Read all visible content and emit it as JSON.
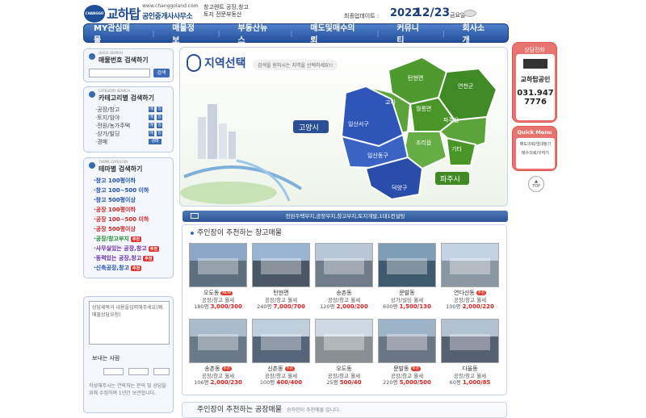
{
  "header": {
    "logo_mark": "CHANGGO",
    "logo_main": "교하탑",
    "logo_url": "www.changgoland.com",
    "logo_sub": "공인중개사사무소",
    "tagline_1": "창고렌트 공장,창고",
    "tagline_2": "토지 전문부동산",
    "update_label": "최종업데이트 :",
    "update_year": "2022",
    "update_date": "12/23",
    "update_day": "금요일"
  },
  "nav": {
    "items": [
      "MY관심매물",
      "매물정보",
      "부동산뉴스",
      "매도및매수의뢰",
      "커뮤니티",
      "회사소개"
    ]
  },
  "quick_search": {
    "small": "QUICK SEARCH",
    "title": "매물번호 검색하기",
    "button": "검색"
  },
  "category_search": {
    "small": "CATEGORY SEARCH",
    "title": "카테고리별 검색하기",
    "rows": [
      "·공장/창고",
      "·토지/임야",
      "·전원/농가주택",
      "·상가/빌딩",
      "·경매"
    ],
    "btn_a": "매",
    "btn_b": "임",
    "btn_wide": "경매"
  },
  "theme_search": {
    "small": "THEME CATEGORY",
    "title": "테마별 검색하기",
    "rows": [
      {
        "text": "·창고 100평이하",
        "color": "#1f4fb0",
        "tag": ""
      },
      {
        "text": "·창고 100~500 이하",
        "color": "#1f4fb0",
        "tag": ""
      },
      {
        "text": "·창고 500평이상",
        "color": "#1f4fb0",
        "tag": ""
      },
      {
        "text": "·공장 100평이하",
        "color": "#d42424",
        "tag": ""
      },
      {
        "text": "·공장 100~500 이하",
        "color": "#d42424",
        "tag": ""
      },
      {
        "text": "·공장 500평이상",
        "color": "#d42424",
        "tag": ""
      },
      {
        "text": "·공장/창고부지",
        "color": "#1c8a2e",
        "tag": "추천"
      },
      {
        "text": "·사무실있는 공장,창고",
        "color": "#6a2aa5",
        "tag": "추천"
      },
      {
        "text": "·동력있는 공장,창고",
        "color": "#6a2aa5",
        "tag": "추천"
      },
      {
        "text": "·신축공장,창고",
        "color": "#1f4fb0",
        "tag": "추천"
      }
    ]
  },
  "contact": {
    "placeholder": "상담제목과 내용을입력해주세요(예:매물상담요청)",
    "sender_label": "보내는 사람",
    "notice": "작성해주시는 연락처는 문의 및 상담을 위해 수집하며 1년간 보관합니다."
  },
  "map": {
    "title": "지역선택",
    "subtitle": "검색을 원하시는 지역을 선택하세요!!",
    "regions": [
      "탄현면",
      "연천군",
      "교하",
      "월롱면",
      "파주읍",
      "일산서구",
      "조리읍",
      "기타",
      "일산동구",
      "덕양구"
    ],
    "goyang": "고양시",
    "paju": "파주시"
  },
  "banner_line": "전원주택부지,공장부지,창고부지,토지개발,1대1컨설팅",
  "recommend": {
    "title": "주인장이 추천하는 창고매물",
    "items": [
      {
        "loc": "오도동",
        "badge": "NEW",
        "type": "공장/창고 월세",
        "area": "180평",
        "price": "3,000/300"
      },
      {
        "loc": "탄현면",
        "badge": "",
        "type": "공장/창고 월세",
        "area": "240평",
        "price": "7,000/700"
      },
      {
        "loc": "송촌동",
        "badge": "",
        "type": "공장/창고 월세",
        "area": "120평",
        "price": "2,000/200"
      },
      {
        "loc": "문발동",
        "badge": "",
        "type": "상가/빌딩 월세",
        "area": "600평",
        "price": "1,500/130"
      },
      {
        "loc": "연다산동",
        "badge": "추천",
        "type": "공장/창고 월세",
        "area": "100평",
        "price": "2,000/220"
      },
      {
        "loc": "송촌동",
        "badge": "추천",
        "type": "공장/창고 월세",
        "area": "106평",
        "price": "2,000/230"
      },
      {
        "loc": "신촌동",
        "badge": "추천",
        "type": "공장/창고 월세",
        "area": "100평",
        "price": "400/400"
      },
      {
        "loc": "오도동",
        "badge": "",
        "type": "공장/창고 월세",
        "area": "25평",
        "price": "500/40"
      },
      {
        "loc": "문발동",
        "badge": "추천",
        "type": "공장/창고 월세",
        "area": "220평",
        "price": "5,000/500"
      },
      {
        "loc": "다율동",
        "badge": "",
        "type": "공장/창고 월세",
        "area": "60평",
        "price": "1,000/85"
      }
    ]
  },
  "recommend2": {
    "title": "주인장이 추천하는 공장매물",
    "sub": "송하인이 추천매물 입니다."
  },
  "side_phone": {
    "title": "상담전화",
    "name": "교하탑공인",
    "tel1": "031.947",
    "tel2": "7776"
  },
  "quick_menu": {
    "title": "Quick Menu",
    "item1": "매도의뢰/임대놓기",
    "item2": "매수의뢰/구하기"
  },
  "top_button": "TOP",
  "colors": {
    "primary": "#1c4a8c",
    "nav": "#2c5597",
    "accent": "#e8746f",
    "price": "#dd2222"
  }
}
